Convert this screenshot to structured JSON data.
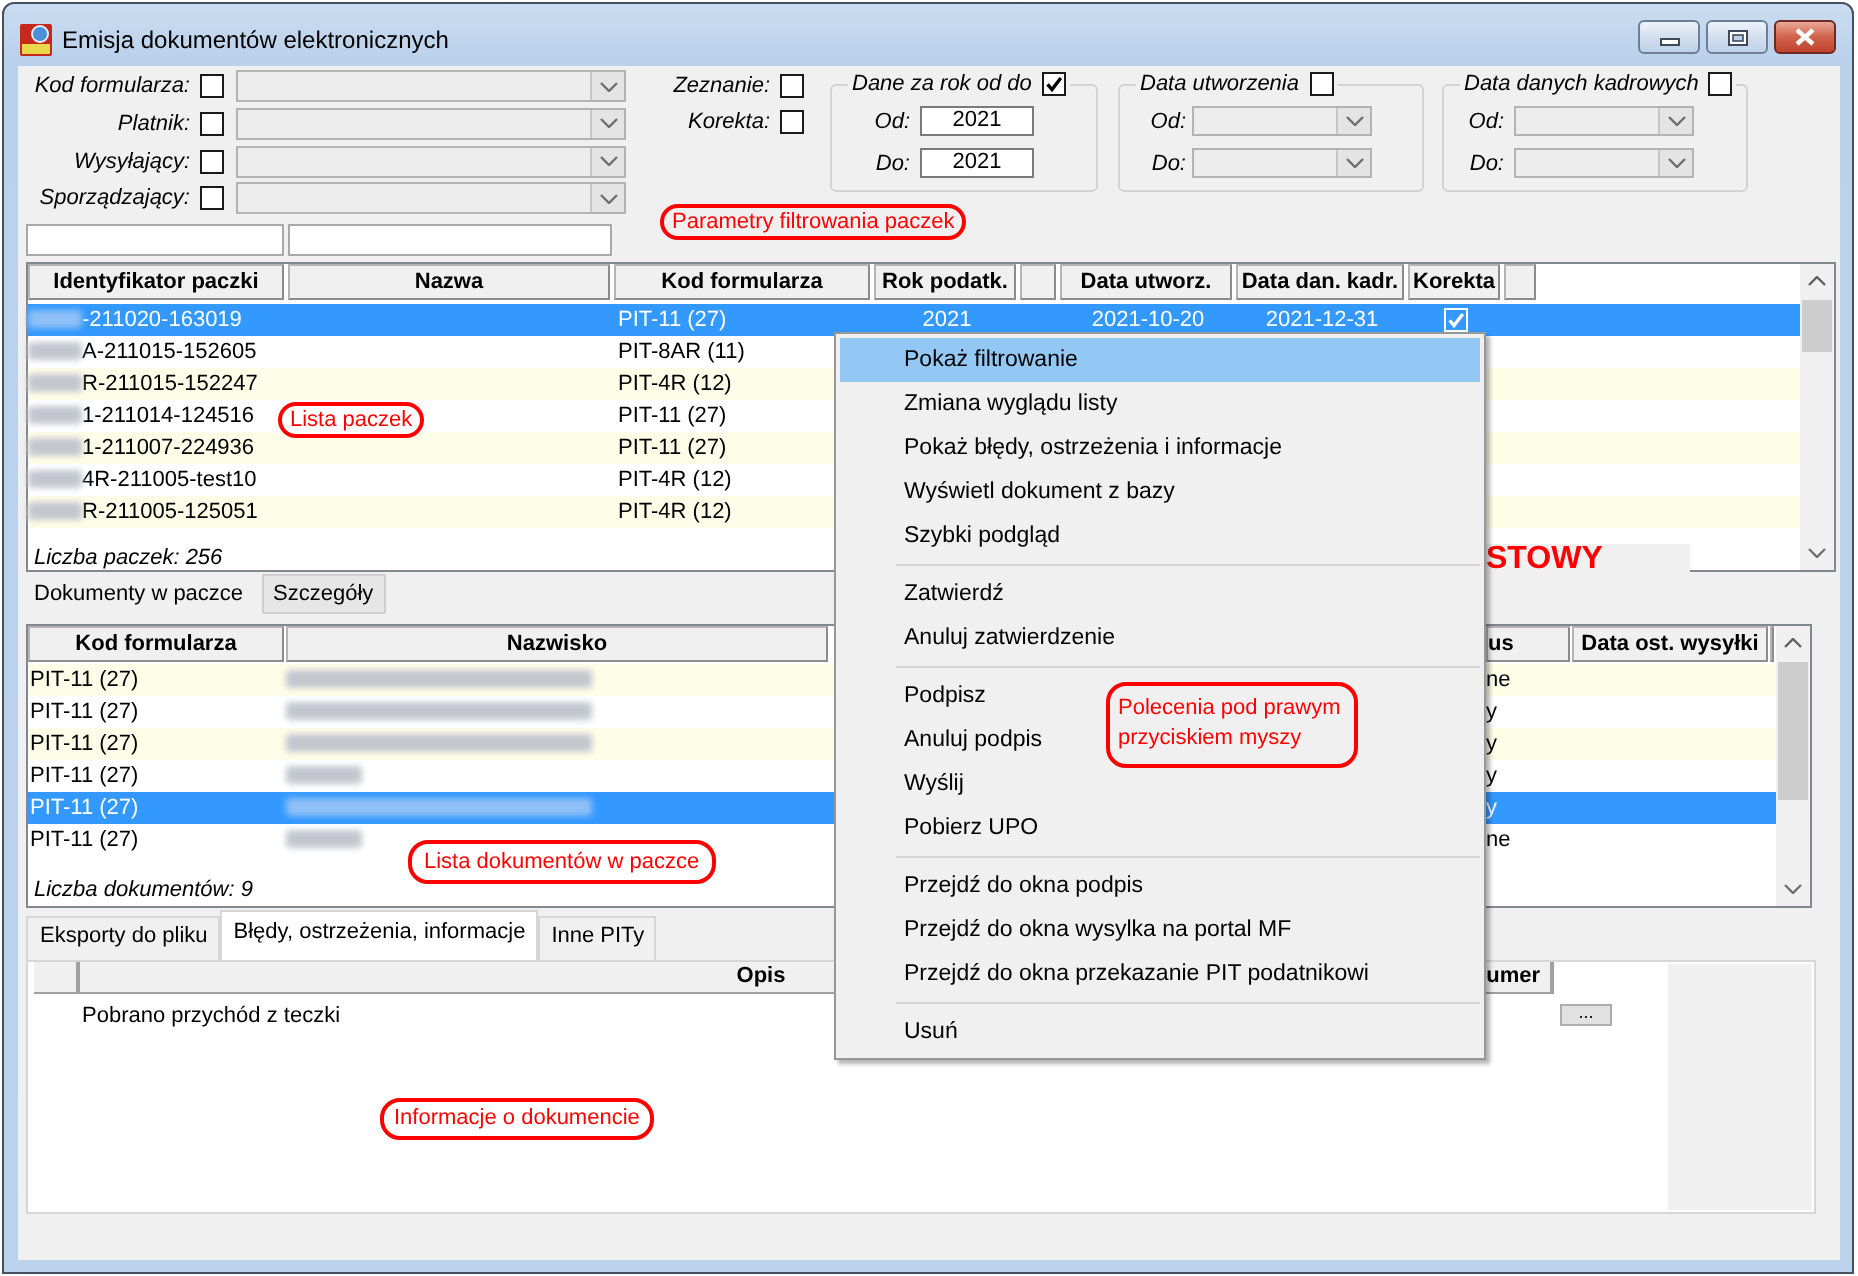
{
  "window": {
    "title": "Emisja dokumentów elektronicznych"
  },
  "filters": {
    "fields": [
      {
        "label": "Kod formularza:",
        "checked": false
      },
      {
        "label": "Platnik:",
        "checked": false
      },
      {
        "label": "Wysyłający:",
        "checked": false
      },
      {
        "label": "Sporządzający:",
        "checked": false
      }
    ],
    "flags": [
      {
        "label": "Zeznanie:",
        "checked": false
      },
      {
        "label": "Korekta:",
        "checked": false
      }
    ],
    "groups": [
      {
        "title": "Dane za rok od do",
        "checked": true,
        "kind": "text",
        "rows": [
          {
            "label": "Od:",
            "value": "2021"
          },
          {
            "label": "Do:",
            "value": "2021"
          }
        ]
      },
      {
        "title": "Data utworzenia",
        "checked": false,
        "kind": "combo",
        "rows": [
          {
            "label": "Od:"
          },
          {
            "label": "Do:"
          }
        ]
      },
      {
        "title": "Data danych kadrowych",
        "checked": false,
        "kind": "combo",
        "rows": [
          {
            "label": "Od:"
          },
          {
            "label": "Do:"
          }
        ]
      }
    ]
  },
  "package_list": {
    "columns": [
      {
        "kind": "text",
        "label": "Identyfikator paczki"
      },
      {
        "kind": "text",
        "label": "Nazwa"
      },
      {
        "kind": "text",
        "label": "Kod formularza"
      },
      {
        "kind": "text",
        "label": "Rok podatk."
      },
      {
        "kind": "blank"
      },
      {
        "kind": "text",
        "label": "Data utworz."
      },
      {
        "kind": "text",
        "label": "Data dan. kadr."
      },
      {
        "kind": "text",
        "label": "Korekta"
      },
      {
        "kind": "blank"
      }
    ],
    "rows": [
      {
        "id": "-211020-163019",
        "redacted": true,
        "form_code": "PIT-11 (27)",
        "tax_year": "2021",
        "created": "2021-10-20",
        "hr_date": "2021-12-31",
        "correction": true,
        "selected": true
      },
      {
        "id": "A-211015-152605",
        "redacted": true,
        "form_code": "PIT-8AR (11)",
        "selected": false
      },
      {
        "id": "R-211015-152247",
        "redacted": true,
        "form_code": "PIT-4R (12)",
        "selected": false
      },
      {
        "id": "1-211014-124516",
        "redacted": true,
        "form_code": "PIT-11 (27)",
        "selected": false
      },
      {
        "id": "1-211007-224936",
        "redacted": true,
        "form_code": "PIT-11 (27)",
        "selected": false
      },
      {
        "id": "4R-211005-test10",
        "redacted": true,
        "form_code": "PIT-4R (12)",
        "selected": false
      },
      {
        "id": "R-211005-125051",
        "redacted": true,
        "form_code": "PIT-4R (12)",
        "selected": false
      }
    ],
    "count": "Liczba paczek: 256",
    "mode_label": "STOWY"
  },
  "package_tabs": [
    {
      "label": "Dokumenty w paczce",
      "selected": true
    },
    {
      "label": "Szczegóły",
      "selected": false
    }
  ],
  "document_list": {
    "columns": [
      {
        "kind": "text",
        "label": "Kod formularza"
      },
      {
        "kind": "text",
        "label": "Nazwisko"
      },
      {
        "kind": "text",
        "label": "us"
      },
      {
        "kind": "text",
        "label": "Data ost. wysyłki"
      },
      {
        "kind": "blank"
      }
    ],
    "rows": [
      {
        "kind": "long",
        "form_code": "PIT-11 (27)",
        "column_3": "ne",
        "selected": false
      },
      {
        "kind": "long",
        "form_code": "PIT-11 (27)",
        "column_3": "y",
        "selected": false
      },
      {
        "kind": "long",
        "form_code": "PIT-11 (27)",
        "column_3": "y",
        "selected": false
      },
      {
        "kind": "short",
        "form_code": "PIT-11 (27)",
        "column_3": "y",
        "selected": false
      },
      {
        "kind": "long",
        "form_code": "PIT-11 (27)",
        "column_3": "y",
        "selected": true
      },
      {
        "kind": "short",
        "form_code": "PIT-11 (27)",
        "column_3": "ne",
        "selected": false
      }
    ],
    "count": "Liczba dokumentów: 9"
  },
  "detail_tabs": [
    {
      "label": "Eksporty do pliku",
      "selected": false
    },
    {
      "label": "Błędy, ostrzeżenia, informacje",
      "selected": true
    },
    {
      "label": "Inne PITy",
      "selected": false
    }
  ],
  "messages": {
    "columns": [
      {
        "kind": "blank"
      },
      {
        "kind": "text",
        "label": "Opis"
      },
      {
        "kind": "text",
        "label": "umer"
      }
    ],
    "rows": [
      {
        "text": "Pobrano przychód z teczki",
        "button": "..."
      }
    ]
  },
  "context_menu": {
    "groups": [
      {
        "items": [
          {
            "label": "Pokaż filtrowanie",
            "selected": true
          },
          {
            "label": "Zmiana wyglądu listy",
            "selected": false
          },
          {
            "label": "Pokaż błędy, ostrzeżenia i informacje",
            "selected": false
          },
          {
            "label": "Wyświetl dokument z bazy",
            "selected": false
          },
          {
            "label": "Szybki podgląd",
            "selected": false
          }
        ]
      },
      {
        "items": [
          {
            "label": "Zatwierdź",
            "selected": false
          },
          {
            "label": "Anuluj zatwierdzenie",
            "selected": false
          }
        ]
      },
      {
        "items": [
          {
            "label": "Podpisz",
            "selected": false
          },
          {
            "label": "Anuluj podpis",
            "selected": false
          },
          {
            "label": "Wyślij",
            "selected": false
          },
          {
            "label": "Pobierz UPO",
            "selected": false
          }
        ]
      },
      {
        "items": [
          {
            "label": "Przejdź do okna podpis",
            "selected": false
          },
          {
            "label": "Przejdź do okna wysylka na portal MF",
            "selected": false
          },
          {
            "label": "Przejdź do okna przekazanie PIT podatnikowi",
            "selected": false
          }
        ]
      },
      {
        "items": [
          {
            "label": "Usuń",
            "selected": false
          }
        ]
      }
    ]
  },
  "annotations": [
    {
      "text": "Parametry filtrowania paczek"
    },
    {
      "text": "Lista paczek"
    },
    {
      "text": "Lista dokumentów w paczce"
    },
    {
      "text": "Informacje o dokumencie"
    },
    {
      "text": "Polecenia pod prawym przyciskiem myszy"
    }
  ]
}
